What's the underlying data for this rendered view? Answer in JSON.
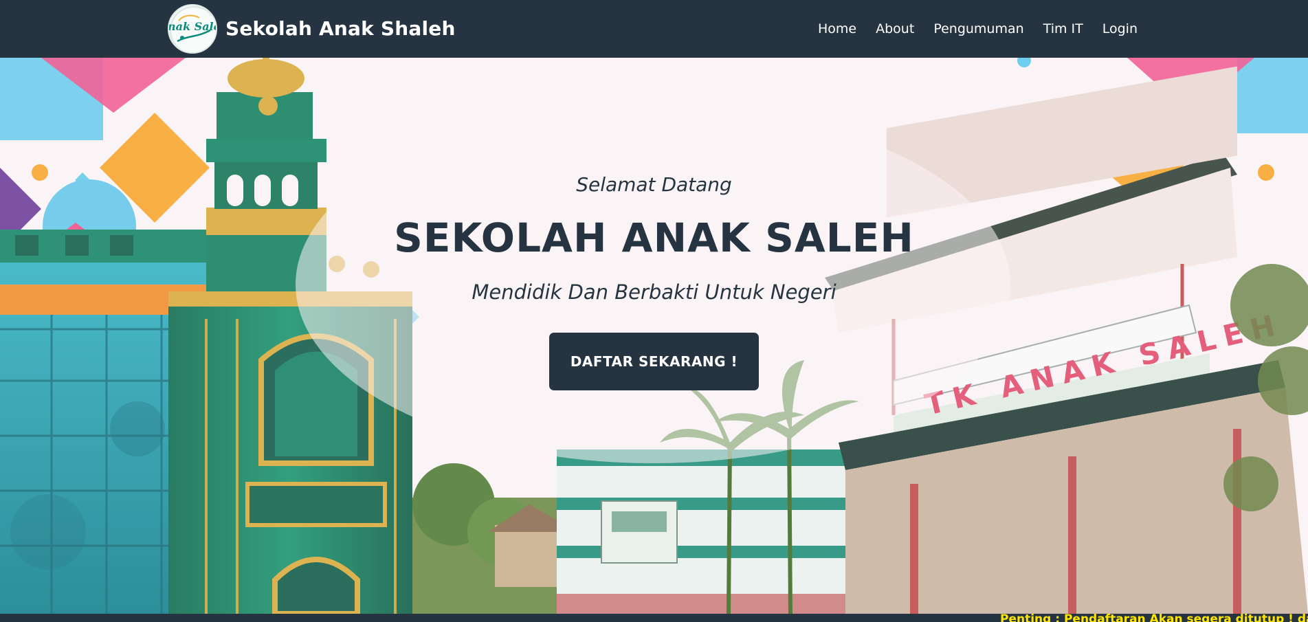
{
  "brand": {
    "name": "Sekolah Anak Shaleh",
    "logo_text": "Anak Saleh"
  },
  "nav": {
    "items": [
      {
        "label": "Home"
      },
      {
        "label": "About"
      },
      {
        "label": "Pengumuman"
      },
      {
        "label": "Tim IT"
      },
      {
        "label": "Login"
      }
    ]
  },
  "hero": {
    "greeting": "Selamat Datang",
    "title": "SEKOLAH ANAK SALEH",
    "tagline": "Mendidik Dan Berbakti Untuk Negeri",
    "cta_label": "DAFTAR SEKARANG !",
    "building_sign": "TK ANAK SALEH"
  },
  "ticker": {
    "text": "Penting : Pendaftaran Akan segera ditutup ! daftar"
  },
  "colors": {
    "navbar": "#263441",
    "hero_text": "#263441",
    "ticker_text": "#ffe600"
  }
}
